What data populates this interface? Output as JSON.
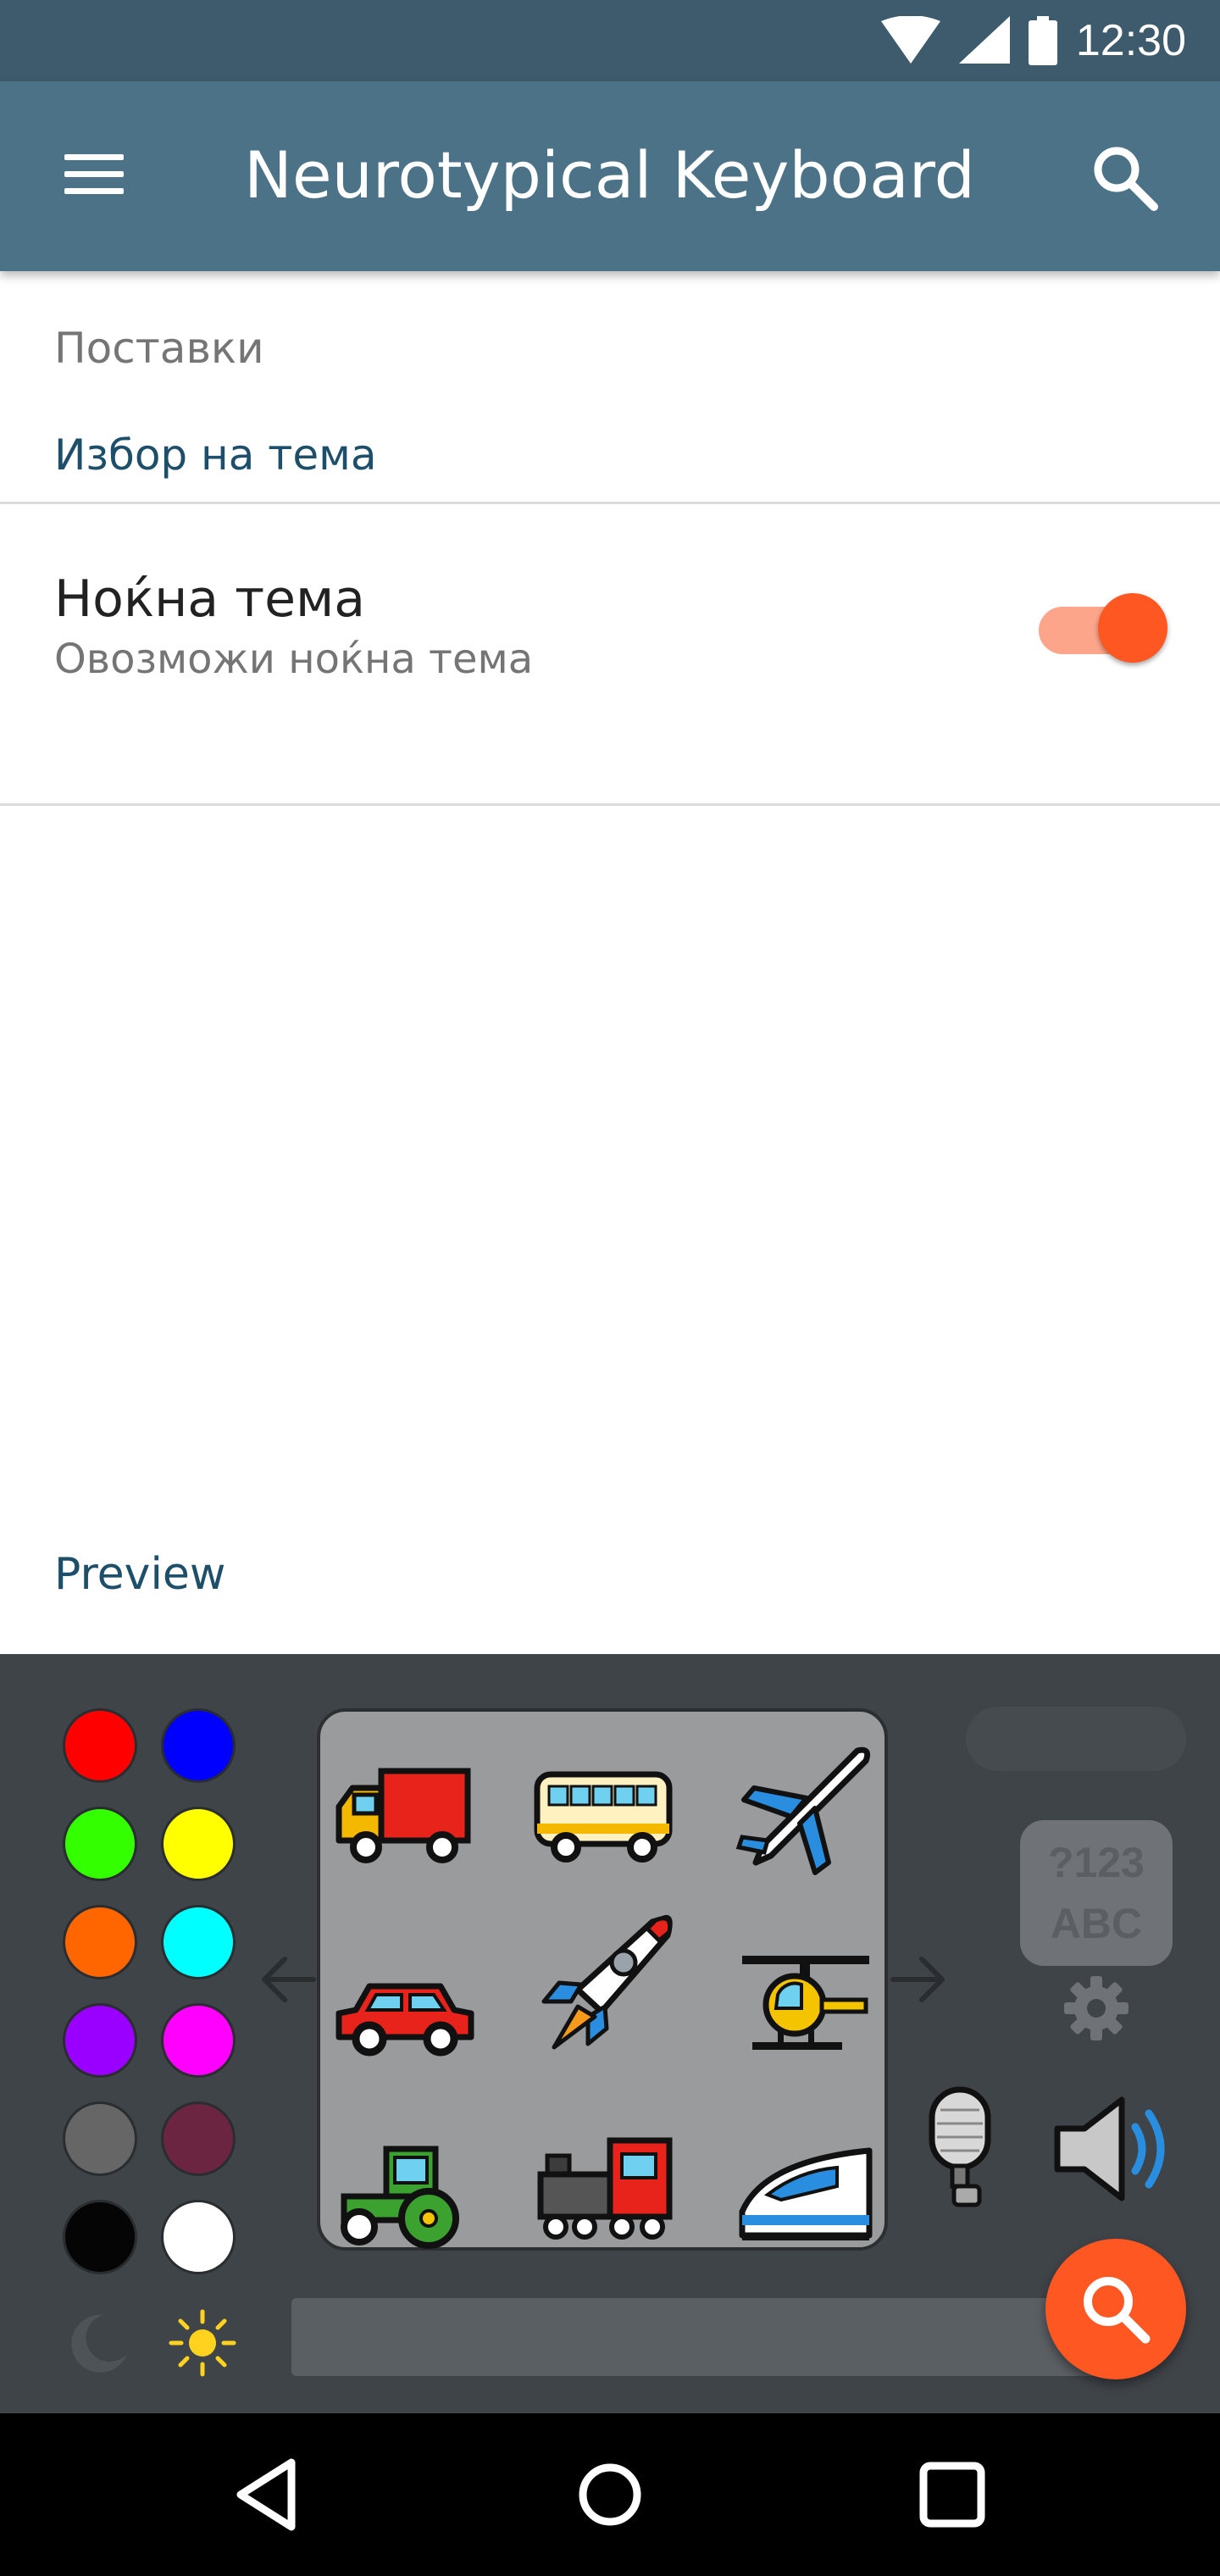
{
  "status_bar": {
    "time": "12:30",
    "icons": [
      "wifi-icon",
      "signal-icon",
      "battery-icon"
    ]
  },
  "app_bar": {
    "title": "Neurotypical Keyboard",
    "menu_icon": "menu-icon",
    "search_icon": "search-icon",
    "color": "#4c7288"
  },
  "settings": {
    "category": "Поставки",
    "subheader": "Избор на тема",
    "night_theme": {
      "title": "Нoќна тема",
      "summary": "Овозможи ноќна тема",
      "enabled": true
    }
  },
  "preview": {
    "label": "Preview",
    "palette": [
      "#ff0000",
      "#0000ff",
      "#33ff00",
      "#ffff00",
      "#ff6600",
      "#00ffff",
      "#9900ff",
      "#ff00ff",
      "#666666",
      "#6b2540",
      "#050505",
      "#ffffff"
    ],
    "vehicles": [
      "delivery-truck-icon",
      "bus-icon",
      "airplane-icon",
      "car-icon",
      "rocket-icon",
      "helicopter-icon",
      "tractor-icon",
      "locomotive-icon",
      "bullet-train-icon"
    ],
    "mode_key": {
      "line1": "?123",
      "line2": "ABC"
    },
    "accent": "#ff5722"
  },
  "nav_bar": {
    "buttons": [
      "back-icon",
      "home-icon",
      "recents-icon"
    ]
  }
}
